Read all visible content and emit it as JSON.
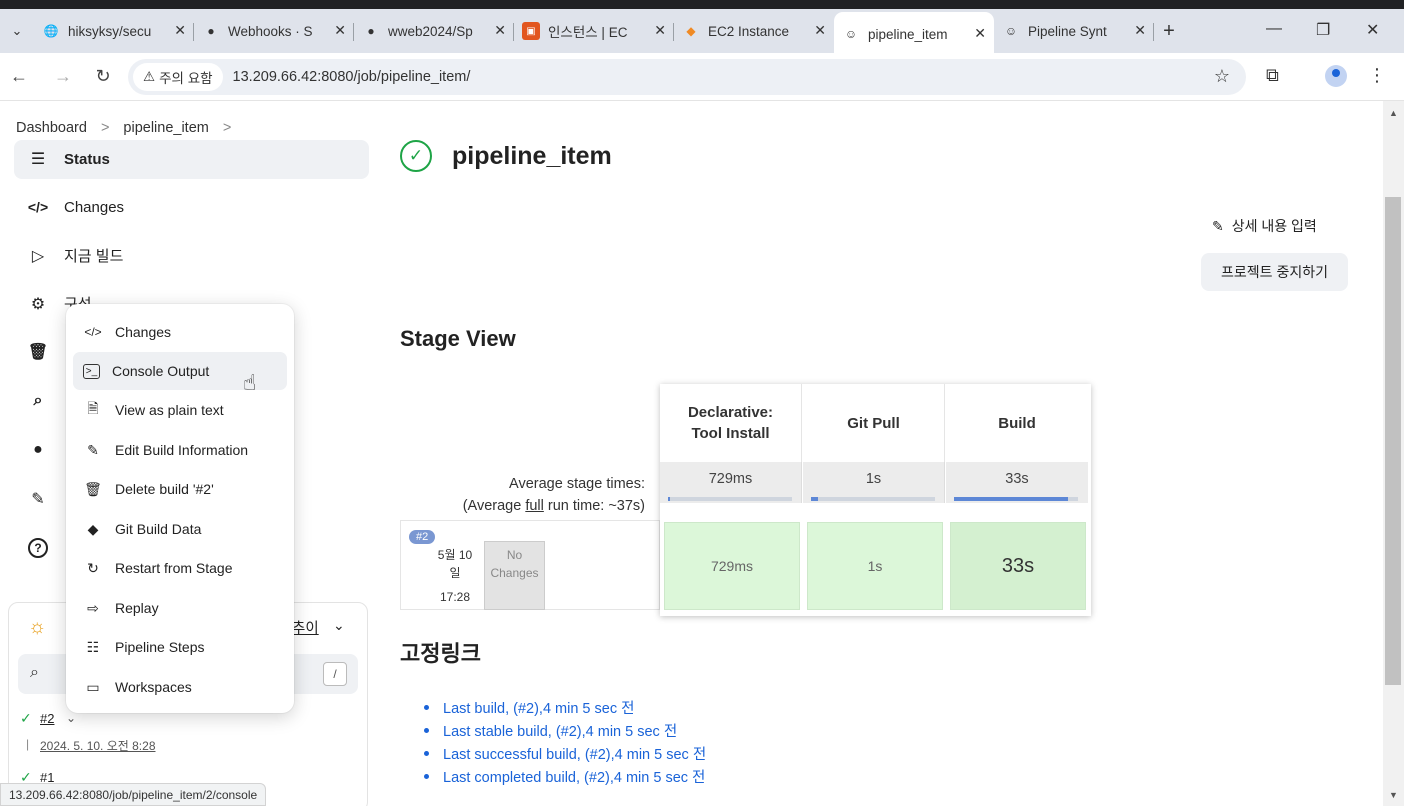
{
  "browser": {
    "tabs": [
      {
        "label": "hiksyksy/secu",
        "icon": "globe-icon"
      },
      {
        "label": "Webhooks · S",
        "icon": "github-icon"
      },
      {
        "label": "wweb2024/Sp",
        "icon": "github-icon"
      },
      {
        "label": "인스턴스 | EC",
        "icon": "aws-icon"
      },
      {
        "label": "EC2 Instance",
        "icon": "cube-icon"
      },
      {
        "label": "pipeline_item",
        "icon": "jenkins-icon",
        "active": true
      },
      {
        "label": "Pipeline Synt",
        "icon": "jenkins-icon"
      }
    ],
    "security_chip": "주의 요함",
    "url": "13.209.66.42:8080/job/pipeline_item/"
  },
  "breadcrumb": {
    "root": "Dashboard",
    "current": "pipeline_item"
  },
  "sidebar": {
    "status": "Status",
    "changes": "Changes",
    "build_now": "지금 빌드",
    "configure": "구성"
  },
  "build_history": {
    "trend_label": "추이",
    "search_shortcut": "/",
    "builds": [
      {
        "number": "#2",
        "date": "2024. 5. 10. 오전 8:28"
      },
      {
        "number": "#1"
      }
    ]
  },
  "context_menu": {
    "items": [
      {
        "label": "Changes",
        "icon": "code-icon"
      },
      {
        "label": "Console Output",
        "icon": "terminal-icon"
      },
      {
        "label": "View as plain text",
        "icon": "document-icon"
      },
      {
        "label": "Edit Build Information",
        "icon": "edit-box-icon"
      },
      {
        "label": "Delete build '#2'",
        "icon": "trash-icon"
      },
      {
        "label": "Git Build Data",
        "icon": "git-icon"
      },
      {
        "label": "Restart from Stage",
        "icon": "refresh-icon"
      },
      {
        "label": "Replay",
        "icon": "replay-icon"
      },
      {
        "label": "Pipeline Steps",
        "icon": "list-icon"
      },
      {
        "label": "Workspaces",
        "icon": "folder-icon"
      }
    ]
  },
  "main": {
    "title": "pipeline_item",
    "edit_description": "상세 내용 입력",
    "disable_project": "프로젝트 중지하기",
    "stage_view_heading": "Stage View",
    "avg_stage_times": "Average stage times:",
    "avg_full_prefix": "(Average ",
    "avg_full_link": "full",
    "avg_full_suffix": " run time: ~37s)",
    "stages": [
      {
        "name_line1": "Declarative:",
        "name_line2": "Tool Install",
        "avg": "729ms",
        "run": "729ms",
        "progress": 0.02
      },
      {
        "name_line1": "Git Pull",
        "name_line2": "",
        "avg": "1s",
        "run": "1s",
        "progress": 0.06
      },
      {
        "name_line1": "Build",
        "name_line2": "",
        "avg": "33s",
        "run": "33s",
        "progress": 0.92
      }
    ],
    "build_row": {
      "badge": "#2",
      "date_line1": "5월 10",
      "date_line2": "일",
      "time": "17:28",
      "no_changes_line1": "No",
      "no_changes_line2": "Changes"
    },
    "permalinks_heading": "고정링크",
    "permalinks": [
      "Last build, (#2),4 min 5 sec 전",
      "Last stable build, (#2),4 min 5 sec 전",
      "Last successful build, (#2),4 min 5 sec 전",
      "Last completed build, (#2),4 min 5 sec 전"
    ]
  },
  "status_bar_url": "13.209.66.42:8080/job/pipeline_item/2/console",
  "colors": {
    "accent": "#1a63d8",
    "success": "#1ea446",
    "stage_ok": "#dcf7d9"
  }
}
